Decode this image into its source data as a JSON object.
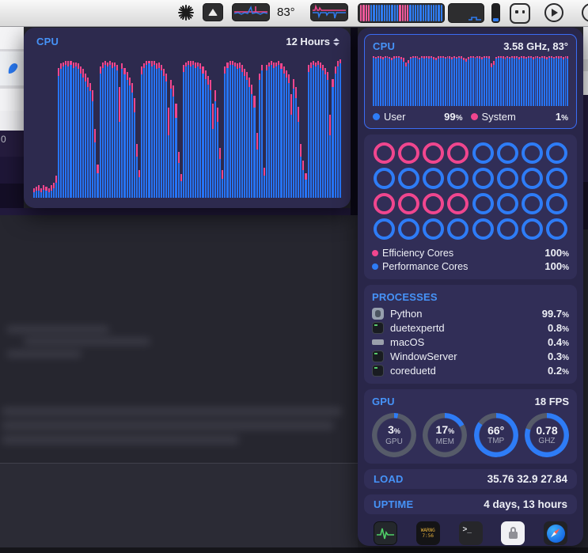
{
  "colors": {
    "accent_blue": "#2e7cf6",
    "accent_pink": "#f0468e",
    "header_blue": "#4693f8",
    "ring_track": "#565b69"
  },
  "menubar": {
    "temperature": "83°",
    "icons": [
      "starburst-icon",
      "eject-widget-icon",
      "cpu-graph-widget-icon",
      "temperature-label",
      "network-graph-widget-icon",
      "cpu-cores-widget-icon",
      "history-graph-widget-icon",
      "battery-pill-icon",
      "outlet-icon",
      "play-icon",
      "partial-circle-icon"
    ],
    "cores_pattern": [
      "p",
      "p",
      "p",
      "p",
      "b",
      "b",
      "b",
      "b",
      "b",
      "b",
      "b",
      "b",
      "b",
      "b",
      "b",
      "p",
      "p",
      "p",
      "p",
      "b",
      "b",
      "b",
      "b",
      "b",
      "b",
      "b",
      "b",
      "b",
      "b",
      "b",
      "b",
      "b"
    ]
  },
  "left_window": {
    "row_text": "0"
  },
  "history_panel": {
    "title": "CPU",
    "range_label": "12 Hours",
    "bars": [
      [
        4,
        3
      ],
      [
        5,
        3
      ],
      [
        5,
        4
      ],
      [
        4,
        3
      ],
      [
        6,
        3
      ],
      [
        5,
        3
      ],
      [
        4,
        3
      ],
      [
        5,
        4
      ],
      [
        7,
        4
      ],
      [
        11,
        5
      ],
      [
        88,
        6
      ],
      [
        93,
        4
      ],
      [
        95,
        3
      ],
      [
        96,
        3
      ],
      [
        95,
        4
      ],
      [
        96,
        3
      ],
      [
        94,
        4
      ],
      [
        95,
        3
      ],
      [
        93,
        4
      ],
      [
        90,
        5
      ],
      [
        87,
        6
      ],
      [
        84,
        6
      ],
      [
        80,
        7
      ],
      [
        77,
        6
      ],
      [
        70,
        8
      ],
      [
        40,
        10
      ],
      [
        18,
        6
      ],
      [
        90,
        5
      ],
      [
        94,
        4
      ],
      [
        96,
        3
      ],
      [
        95,
        3
      ],
      [
        96,
        3
      ],
      [
        94,
        4
      ],
      [
        95,
        3
      ],
      [
        92,
        4
      ],
      [
        55,
        25
      ],
      [
        93,
        4
      ],
      [
        89,
        5
      ],
      [
        85,
        6
      ],
      [
        81,
        6
      ],
      [
        76,
        7
      ],
      [
        62,
        10
      ],
      [
        30,
        9
      ],
      [
        15,
        5
      ],
      [
        89,
        6
      ],
      [
        94,
        3
      ],
      [
        96,
        3
      ],
      [
        97,
        2
      ],
      [
        95,
        4
      ],
      [
        96,
        3
      ],
      [
        93,
        4
      ],
      [
        94,
        4
      ],
      [
        92,
        4
      ],
      [
        88,
        5
      ],
      [
        84,
        6
      ],
      [
        45,
        20
      ],
      [
        79,
        6
      ],
      [
        73,
        8
      ],
      [
        58,
        10
      ],
      [
        25,
        8
      ],
      [
        12,
        5
      ],
      [
        91,
        5
      ],
      [
        95,
        3
      ],
      [
        96,
        3
      ],
      [
        95,
        4
      ],
      [
        96,
        3
      ],
      [
        94,
        4
      ],
      [
        95,
        3
      ],
      [
        93,
        4
      ],
      [
        90,
        5
      ],
      [
        86,
        6
      ],
      [
        82,
        6
      ],
      [
        78,
        7
      ],
      [
        50,
        18
      ],
      [
        70,
        8
      ],
      [
        55,
        10
      ],
      [
        28,
        8
      ],
      [
        14,
        6
      ],
      [
        90,
        5
      ],
      [
        94,
        4
      ],
      [
        96,
        3
      ],
      [
        96,
        3
      ],
      [
        95,
        3
      ],
      [
        93,
        4
      ],
      [
        94,
        4
      ],
      [
        91,
        5
      ],
      [
        88,
        5
      ],
      [
        85,
        6
      ],
      [
        80,
        7
      ],
      [
        75,
        7
      ],
      [
        65,
        9
      ],
      [
        35,
        12
      ],
      [
        85,
        5
      ],
      [
        92,
        4
      ],
      [
        16,
        6
      ],
      [
        92,
        4
      ],
      [
        95,
        3
      ],
      [
        96,
        3
      ],
      [
        94,
        4
      ],
      [
        95,
        3
      ],
      [
        96,
        3
      ],
      [
        93,
        4
      ],
      [
        90,
        5
      ],
      [
        87,
        5
      ],
      [
        83,
        6
      ],
      [
        60,
        15
      ],
      [
        79,
        7
      ],
      [
        72,
        8
      ],
      [
        55,
        11
      ],
      [
        30,
        9
      ],
      [
        20,
        7
      ],
      [
        13,
        5
      ],
      [
        91,
        5
      ],
      [
        94,
        4
      ],
      [
        96,
        3
      ],
      [
        95,
        3
      ],
      [
        96,
        3
      ],
      [
        94,
        4
      ],
      [
        92,
        4
      ],
      [
        89,
        5
      ],
      [
        85,
        6
      ],
      [
        45,
        15
      ],
      [
        80,
        6
      ],
      [
        90,
        5
      ],
      [
        95,
        4
      ],
      [
        97,
        3
      ]
    ]
  },
  "detail_panel": {
    "cpu_card": {
      "title": "CPU",
      "status": "3.58 GHz, 83°",
      "legend": [
        {
          "label": "User",
          "value": "99",
          "unit": "%",
          "color": "#2e7cf6"
        },
        {
          "label": "System",
          "value": "1",
          "unit": "%",
          "color": "#f0468e"
        }
      ],
      "bars": [
        [
          95,
          3
        ],
        [
          93,
          4
        ],
        [
          96,
          3
        ],
        [
          94,
          4
        ],
        [
          92,
          5
        ],
        [
          95,
          3
        ],
        [
          96,
          3
        ],
        [
          93,
          4
        ],
        [
          90,
          6
        ],
        [
          94,
          4
        ],
        [
          96,
          3
        ],
        [
          95,
          3
        ],
        [
          92,
          5
        ],
        [
          88,
          7
        ],
        [
          78,
          8
        ],
        [
          85,
          6
        ],
        [
          93,
          4
        ],
        [
          95,
          3
        ],
        [
          96,
          3
        ],
        [
          94,
          4
        ],
        [
          92,
          4
        ],
        [
          95,
          3
        ],
        [
          93,
          5
        ],
        [
          96,
          3
        ],
        [
          94,
          4
        ],
        [
          95,
          3
        ],
        [
          92,
          5
        ],
        [
          90,
          6
        ],
        [
          94,
          4
        ],
        [
          96,
          3
        ],
        [
          95,
          3
        ],
        [
          93,
          4
        ],
        [
          96,
          3
        ],
        [
          94,
          4
        ],
        [
          92,
          5
        ],
        [
          95,
          3
        ],
        [
          93,
          4
        ],
        [
          96,
          3
        ],
        [
          94,
          4
        ],
        [
          90,
          6
        ],
        [
          87,
          7
        ],
        [
          92,
          5
        ],
        [
          95,
          3
        ],
        [
          96,
          3
        ],
        [
          93,
          4
        ],
        [
          95,
          3
        ],
        [
          94,
          4
        ],
        [
          92,
          5
        ],
        [
          95,
          3
        ],
        [
          96,
          3
        ],
        [
          94,
          4
        ],
        [
          76,
          9
        ],
        [
          82,
          7
        ],
        [
          93,
          4
        ],
        [
          95,
          3
        ],
        [
          96,
          3
        ],
        [
          94,
          4
        ],
        [
          92,
          5
        ],
        [
          95,
          3
        ],
        [
          93,
          4
        ],
        [
          96,
          3
        ],
        [
          94,
          4
        ],
        [
          95,
          3
        ],
        [
          92,
          5
        ],
        [
          96,
          3
        ],
        [
          94,
          4
        ],
        [
          93,
          4
        ],
        [
          95,
          3
        ],
        [
          96,
          3
        ],
        [
          92,
          5
        ],
        [
          94,
          4
        ],
        [
          95,
          3
        ],
        [
          93,
          4
        ],
        [
          96,
          3
        ],
        [
          94,
          4
        ],
        [
          92,
          5
        ],
        [
          95,
          3
        ],
        [
          96,
          3
        ],
        [
          93,
          4
        ],
        [
          95,
          3
        ],
        [
          94,
          4
        ],
        [
          96,
          3
        ],
        [
          92,
          5
        ],
        [
          95,
          3
        ],
        [
          94,
          4
        ]
      ]
    },
    "cores_card": {
      "grid": [
        "p",
        "p",
        "p",
        "p",
        "b",
        "b",
        "b",
        "b",
        "b",
        "b",
        "b",
        "b",
        "b",
        "b",
        "b",
        "b",
        "p",
        "p",
        "p",
        "p",
        "b",
        "b",
        "b",
        "b",
        "b",
        "b",
        "b",
        "b",
        "b",
        "b",
        "b",
        "b"
      ],
      "legend": [
        {
          "label": "Efficiency Cores",
          "value": "100",
          "unit": "%",
          "color": "#f0468e"
        },
        {
          "label": "Performance Cores",
          "value": "100",
          "unit": "%",
          "color": "#2e7cf6"
        }
      ]
    },
    "processes_card": {
      "title": "PROCESSES",
      "rows": [
        {
          "name": "Python",
          "value": "99.7",
          "unit": "%",
          "icon": "python"
        },
        {
          "name": "duetexpertd",
          "value": "0.8",
          "unit": "%",
          "icon": "term"
        },
        {
          "name": "macOS",
          "value": "0.4",
          "unit": "%",
          "icon": "mac"
        },
        {
          "name": "WindowServer",
          "value": "0.3",
          "unit": "%",
          "icon": "term"
        },
        {
          "name": "coreduetd",
          "value": "0.2",
          "unit": "%",
          "icon": "term"
        }
      ]
    },
    "gpu_card": {
      "title": "GPU",
      "fps": "18 FPS",
      "gauges": [
        {
          "value": "3",
          "suffix": "%",
          "label": "GPU",
          "pct": 3
        },
        {
          "value": "17",
          "suffix": "%",
          "label": "MEM",
          "pct": 17
        },
        {
          "value": "66°",
          "suffix": "",
          "label": "TMP",
          "pct": 85
        },
        {
          "value": "0.78",
          "suffix": "",
          "label": "GHZ",
          "pct": 80
        }
      ]
    },
    "load_card": {
      "title": "LOAD",
      "value": "35.76 32.9 27.84"
    },
    "uptime_card": {
      "title": "UPTIME",
      "value": "4 days, 13 hours"
    },
    "dock": {
      "timer_line1": "WARNG",
      "timer_line2": "7:56",
      "terminal_glyph": ">_",
      "icons": [
        "activity-monitor-icon",
        "timer-display-icon",
        "terminal-icon",
        "lock-app-icon",
        "safari-icon"
      ]
    }
  }
}
